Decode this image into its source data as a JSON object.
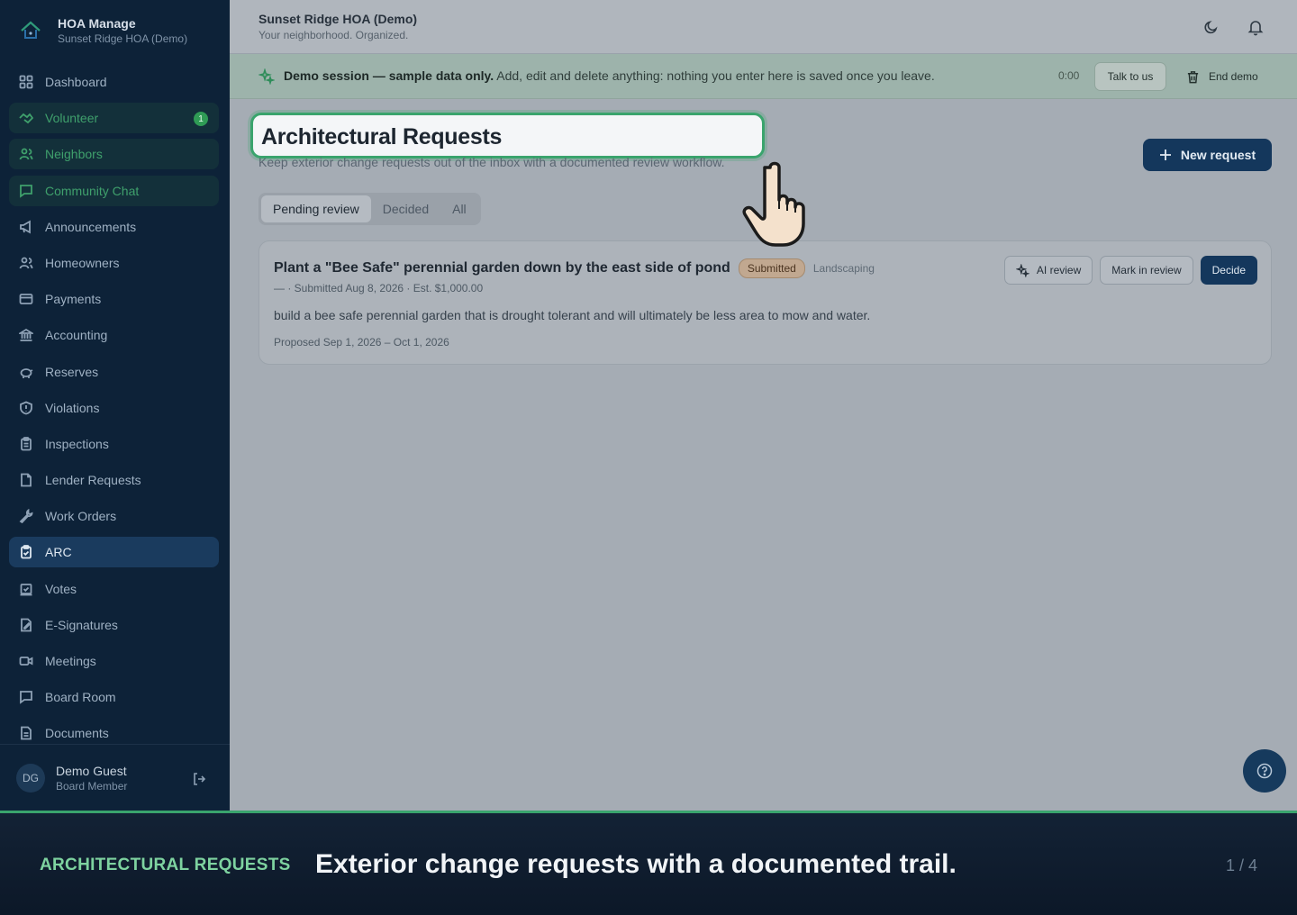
{
  "brand": {
    "name": "HOA Manage",
    "org": "Sunset Ridge HOA (Demo)"
  },
  "sidebar": {
    "items": [
      {
        "label": "Dashboard",
        "icon": "dashboard-icon",
        "state": "normal"
      },
      {
        "label": "Volunteer",
        "icon": "handshake-icon",
        "state": "green",
        "badge": "1"
      },
      {
        "label": "Neighbors",
        "icon": "users-icon",
        "state": "green"
      },
      {
        "label": "Community Chat",
        "icon": "chat-icon",
        "state": "green"
      },
      {
        "label": "Announcements",
        "icon": "megaphone-icon",
        "state": "normal"
      },
      {
        "label": "Homeowners",
        "icon": "users-icon",
        "state": "normal"
      },
      {
        "label": "Payments",
        "icon": "card-icon",
        "state": "normal"
      },
      {
        "label": "Accounting",
        "icon": "bank-icon",
        "state": "normal"
      },
      {
        "label": "Reserves",
        "icon": "piggy-bank-icon",
        "state": "normal"
      },
      {
        "label": "Violations",
        "icon": "shield-icon",
        "state": "normal"
      },
      {
        "label": "Inspections",
        "icon": "clipboard-icon",
        "state": "normal"
      },
      {
        "label": "Lender Requests",
        "icon": "file-icon",
        "state": "normal"
      },
      {
        "label": "Work Orders",
        "icon": "wrench-icon",
        "state": "normal"
      },
      {
        "label": "ARC",
        "icon": "clipboard-check-icon",
        "state": "active"
      },
      {
        "label": "Votes",
        "icon": "ballot-icon",
        "state": "normal"
      },
      {
        "label": "E-Signatures",
        "icon": "signature-icon",
        "state": "normal"
      },
      {
        "label": "Meetings",
        "icon": "video-icon",
        "state": "normal"
      },
      {
        "label": "Board Room",
        "icon": "chat-square-icon",
        "state": "normal"
      },
      {
        "label": "Documents",
        "icon": "document-icon",
        "state": "normal"
      }
    ]
  },
  "user": {
    "initials": "DG",
    "name": "Demo Guest",
    "role": "Board Member"
  },
  "topbar": {
    "org": "Sunset Ridge HOA (Demo)",
    "tagline": "Your neighborhood. Organized."
  },
  "demo": {
    "bold": "Demo session — sample data only.",
    "rest": " Add, edit and delete anything: nothing you enter here is saved once you leave.",
    "timer": "0:00",
    "talk": "Talk to us",
    "end": "End demo"
  },
  "page": {
    "title": "Architectural Requests",
    "subtitle": "Keep exterior change requests out of the inbox with a documented review workflow.",
    "new_button": "New request",
    "tabs": [
      "Pending review",
      "Decided",
      "All"
    ]
  },
  "request": {
    "title": "Plant a \"Bee Safe\" perennial garden down by the east side of pond",
    "status": "Submitted",
    "category": "Landscaping",
    "meta": "— · Submitted Aug 8, 2026 · Est. $1,000.00",
    "description": "build a bee safe perennial garden that is drought tolerant and will ultimately be less area to mow and water.",
    "dates": "Proposed Sep 1, 2026 – Oct 1, 2026",
    "actions": {
      "ai": "AI review",
      "mark": "Mark in review",
      "decide": "Decide"
    }
  },
  "caption": {
    "kicker": "ARCHITECTURAL REQUESTS",
    "headline": "Exterior change requests with a documented trail.",
    "pager": "1 / 4"
  },
  "colors": {
    "accent": "#3aa46d",
    "navy": "#14375c",
    "sidebar": "#0d2238"
  }
}
